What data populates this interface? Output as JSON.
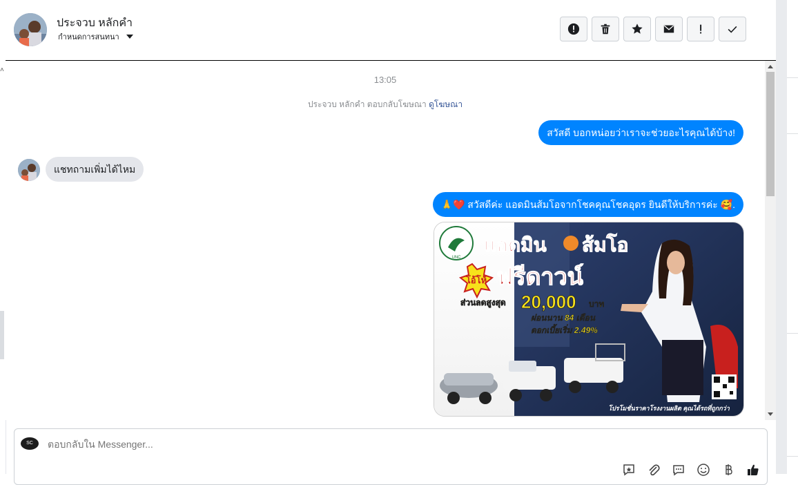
{
  "header": {
    "contact_name": "ประจวบ หลักคำ",
    "assign_label": "กำหนดการสนทนา",
    "actions": [
      {
        "name": "mark-spam-button",
        "icon": "alert-circle-icon"
      },
      {
        "name": "delete-button",
        "icon": "trash-icon"
      },
      {
        "name": "star-button",
        "icon": "star-icon"
      },
      {
        "name": "mark-unread-button",
        "icon": "envelope-icon"
      },
      {
        "name": "follow-up-button",
        "icon": "exclamation-icon"
      },
      {
        "name": "mark-done-button",
        "icon": "check-icon"
      }
    ]
  },
  "chat": {
    "time": "13:05",
    "system_note_text": "ประจวบ หลักคำ ตอบกลับโฆษณา",
    "system_note_link": "ดูโฆษณา",
    "messages": [
      {
        "direction": "out",
        "text": "สวัสดี บอกหน่อยว่าเราจะช่วยอะไรคุณได้บ้าง!"
      },
      {
        "direction": "in",
        "text": "แชทถามเพิ่มได้ไหม"
      },
      {
        "direction": "out",
        "emoji_prefix": "🙏❤️",
        "text": "สวัสดีค่ะ แอดมินส้มโอจากโชคคุณโชคอุดร ยินดีให้บริการค่ะ",
        "emoji_suffix": "🥰."
      }
    ],
    "ad": {
      "title_1": "แอดมิน",
      "title_2": "ส้มโอ",
      "badge": "โอ้โห้",
      "headline": "ฟรีดาวน์",
      "discount_label": "ส่วนลดสูงสุด",
      "discount_value": "20,000",
      "discount_unit": "บาท",
      "installment": "ผ่อนนาน 84 เดือน",
      "interest": "ดอกเบี้ยเริ่ม 2.49%",
      "footer": "โปรโมชั่นราคาโรงงานผลิต คุณได้รถที่ถูกกว่า",
      "logo_text": "UNC"
    }
  },
  "composer": {
    "placeholder": "ตอบกลับใน Messenger...",
    "page_avatar_text": "SC",
    "tools": [
      "saved-reply-icon",
      "attach-icon",
      "chat-bubble-icon",
      "emoji-icon",
      "baht-icon",
      "thumbs-up-icon"
    ]
  },
  "colors": {
    "accent": "#0084ff",
    "incoming_bubble": "#e4e6eb",
    "link": "#385898"
  }
}
